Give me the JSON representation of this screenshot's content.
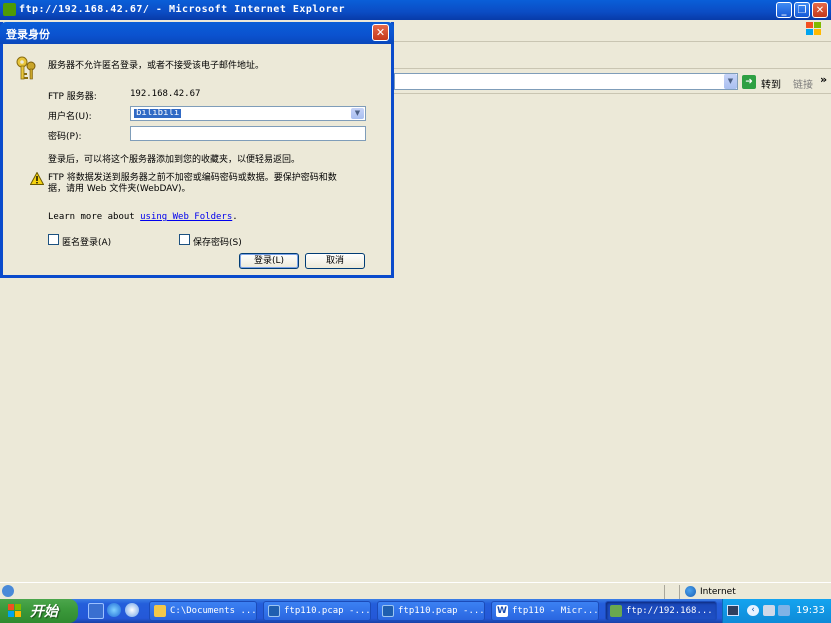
{
  "ie_window": {
    "title": "ftp://192.168.42.67/ - Microsoft Internet Explorer",
    "go_label": "转到",
    "links_label": "链接",
    "links_chevron": "»",
    "status_zone": "Internet"
  },
  "dialog": {
    "title": "登录身份",
    "message": "服务器不允许匿名登录，或者不接受该电子邮件地址。",
    "server_label": "FTP 服务器:",
    "server_value": "192.168.42.67",
    "username_label": "用户名(U):",
    "username_value": "bilibili",
    "password_label": "密码(P):",
    "password_value": "",
    "favorites_text": "登录后，可以将这个服务器添加到您的收藏夹，以便轻易返回。",
    "warning_line1": "FTP 将数据发送到服务器之前不加密或编码密码或数据。要保护密码和数",
    "warning_line2": "据，请用 Web 文件夹(WebDAV)。",
    "learn_more_prefix": "Learn more about",
    "learn_more_link": "using Web Folders",
    "learn_more_suffix": ".",
    "anonymous_label": "匿名登录(A)",
    "anonymous_checked": false,
    "save_password_label": "保存密码(S)",
    "save_password_checked": false,
    "login_button": "登录(L)",
    "cancel_button": "取消"
  },
  "taskbar": {
    "start_label": "开始",
    "tasks": [
      {
        "label": "C:\\Documents ...",
        "icon": "folder-icon"
      },
      {
        "label": "ftp110.pcap -...",
        "icon": "wireshark-icon"
      },
      {
        "label": "ftp110.pcap -...",
        "icon": "wireshark-icon"
      },
      {
        "label": "ftp110 - Micr...",
        "icon": "word-icon"
      },
      {
        "label": "ftp://192.168...",
        "icon": "ie-icon"
      }
    ],
    "clock": "19:33"
  },
  "colors": {
    "titlebar_blue": "#0b52cf",
    "start_green": "#3c9a3c",
    "dialog_bg": "#ece9d8",
    "link_blue": "#0000ee"
  }
}
